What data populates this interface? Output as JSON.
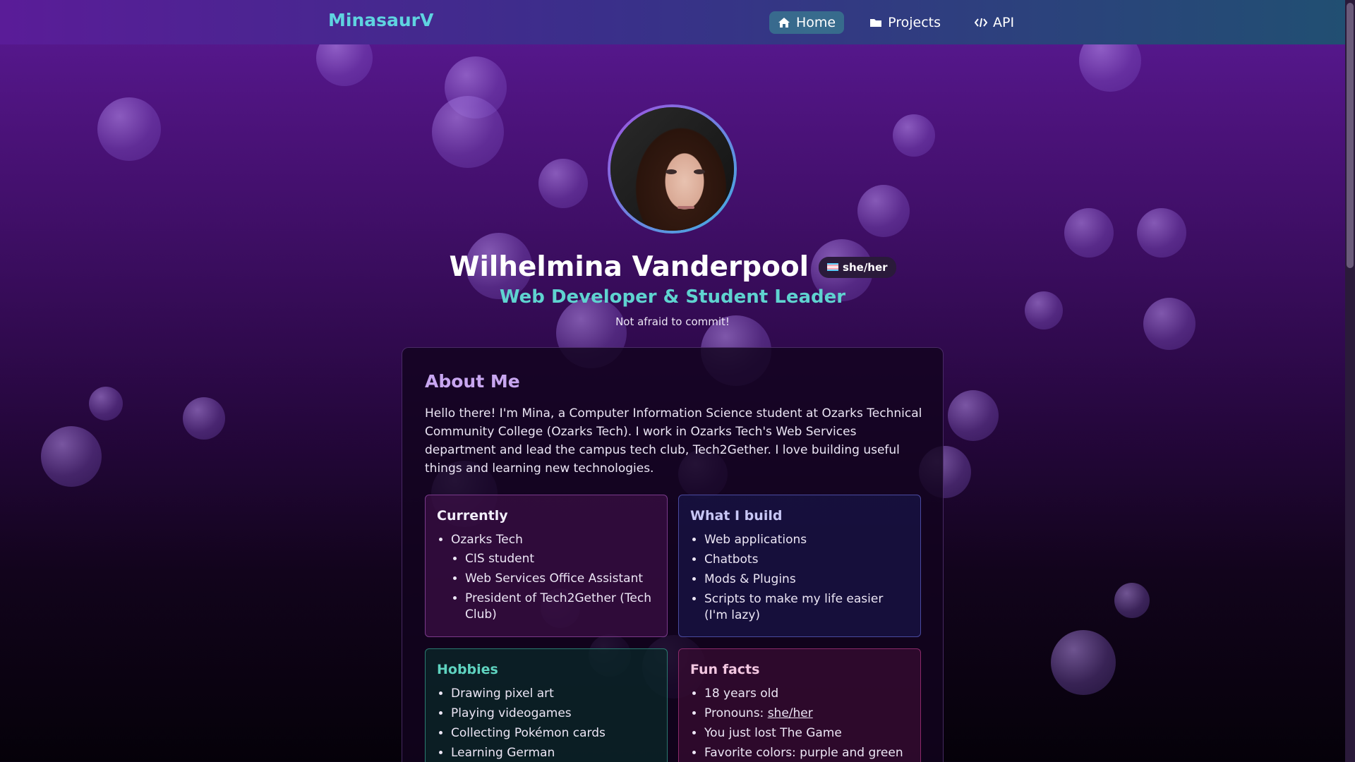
{
  "navbar": {
    "brand": "MinasaurV",
    "links": [
      {
        "label": "Home",
        "icon": "home-icon",
        "active": true
      },
      {
        "label": "Projects",
        "icon": "folder-icon",
        "active": false
      },
      {
        "label": "API",
        "icon": "code-icon",
        "active": false
      }
    ]
  },
  "profile": {
    "name": "Wilhelmina Vanderpool",
    "pronouns": "she/her",
    "title": "Web Developer & Student Leader",
    "tagline": "Not afraid to commit!"
  },
  "about": {
    "heading": "About Me",
    "text": "Hello there! I'm Mina, a Computer Information Science student at Ozarks Technical Community College (Ozarks Tech). I work in Ozarks Tech's Web Services department and lead the campus tech club, Tech2Gether. I love building useful things and learning new technologies.",
    "currently": {
      "heading": "Currently",
      "org": "Ozarks Tech",
      "items": [
        "CIS student",
        "Web Services Office Assistant",
        "President of Tech2Gether (Tech Club)"
      ]
    },
    "build": {
      "heading": "What I build",
      "items": [
        "Web applications",
        "Chatbots",
        "Mods & Plugins",
        "Scripts to make my life easier (I'm lazy)"
      ]
    },
    "hobbies": {
      "heading": "Hobbies",
      "items": [
        "Drawing pixel art",
        "Playing videogames",
        "Collecting Pokémon cards",
        "Learning German"
      ]
    },
    "fun": {
      "heading": "Fun facts",
      "items": [
        "18 years old",
        "You just lost The Game",
        "Favorite colors: purple and green"
      ],
      "pronouns_label": "Pronouns: ",
      "pronouns_value": "she/her"
    }
  },
  "colors": {
    "brand": "#5fd3e0",
    "accent_teal": "#5fd3d0",
    "heading_purple": "#c8a6f0"
  }
}
